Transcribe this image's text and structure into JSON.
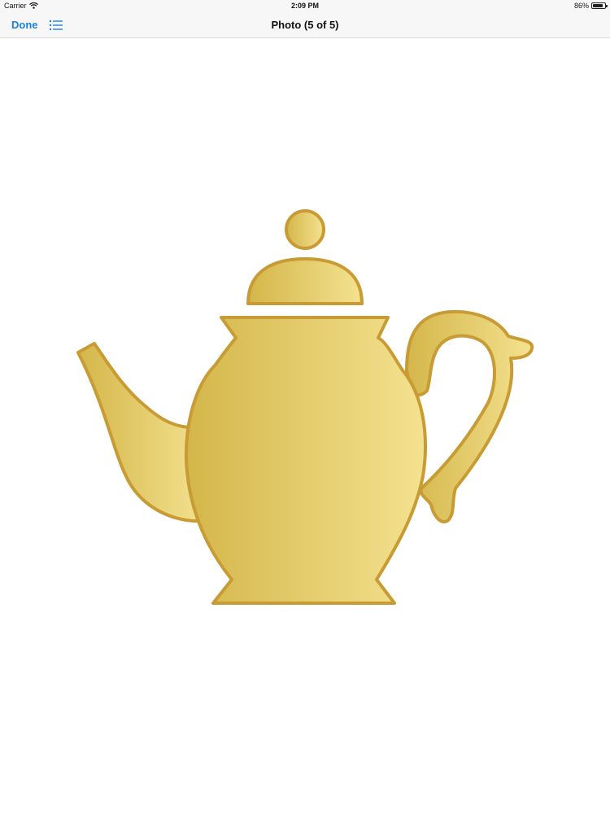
{
  "status_bar": {
    "carrier": "Carrier",
    "time": "2:09 PM",
    "battery_text": "86%",
    "battery_level": 0.86
  },
  "nav": {
    "done_label": "Done",
    "title": "Photo (5 of 5)",
    "list_icon": "list-icon",
    "tint_color": "#1a82e2"
  },
  "photo": {
    "subject_icon": "teapot-image",
    "fill_light": "#f4e290",
    "fill_dark": "#d4b64a",
    "stroke_color": "#c89b35"
  }
}
